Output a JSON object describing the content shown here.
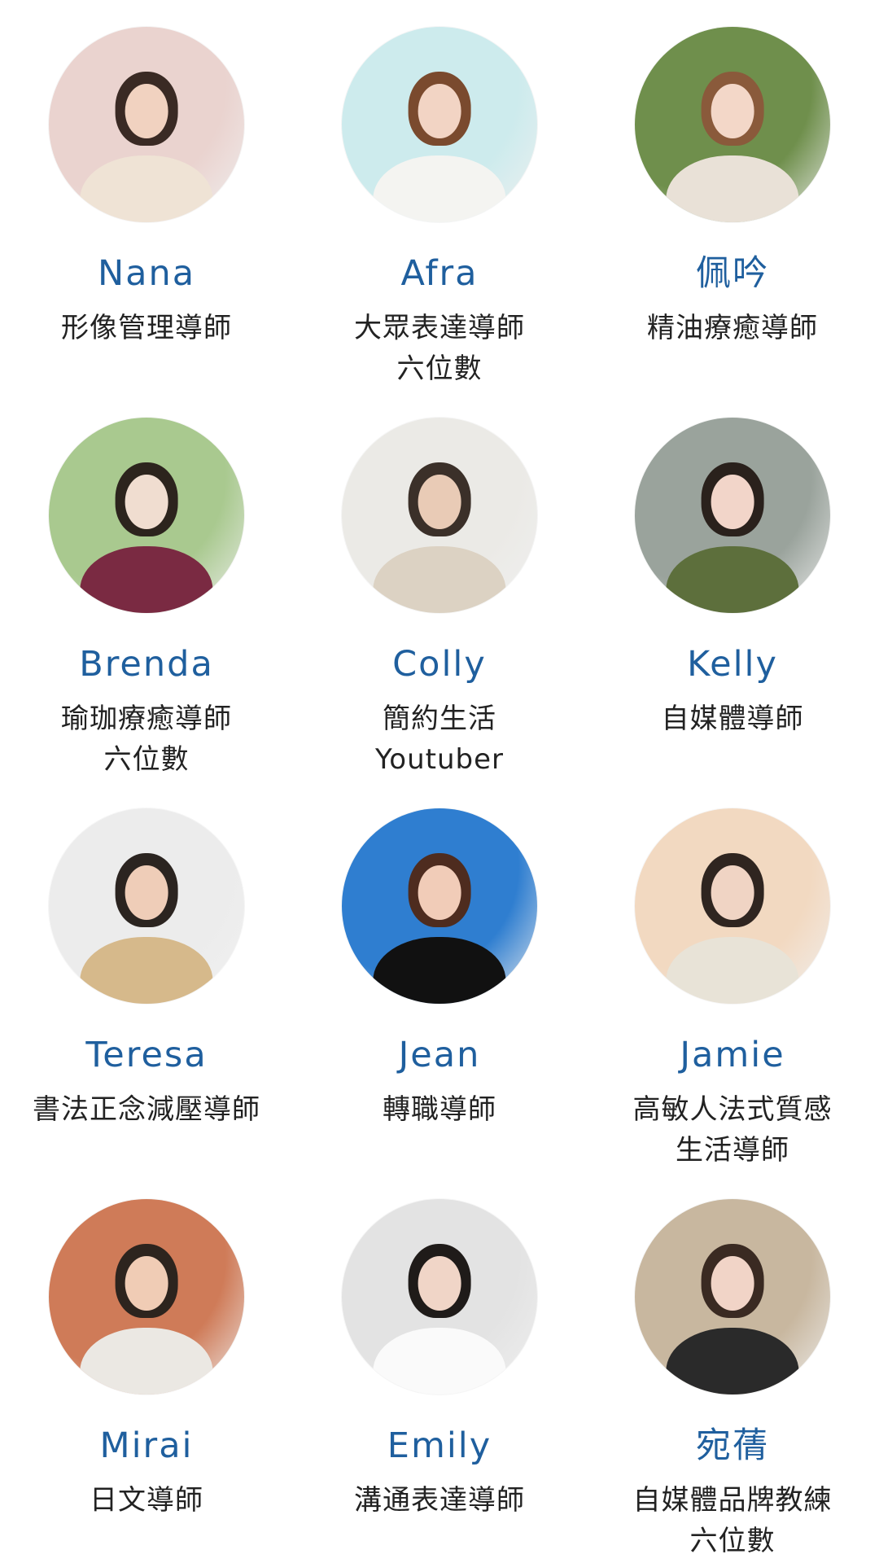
{
  "profiles": [
    {
      "name": "Nana",
      "role_lines": [
        "形像管理導師"
      ],
      "bg": "#ead3cf",
      "hair": "#3a2a24",
      "skin": "#f1d2c0",
      "body": "#efe3d5"
    },
    {
      "name": "Afra",
      "role_lines": [
        "大眾表達導師",
        "六位數"
      ],
      "bg": "#cdebed",
      "hair": "#7a4a2e",
      "skin": "#f2d4c4",
      "body": "#f4f4f1"
    },
    {
      "name": "佩吟",
      "role_lines": [
        "精油療癒導師"
      ],
      "bg": "#6f8f4c",
      "hair": "#8a5a3b",
      "skin": "#f3d7c8",
      "body": "#e9e1d7"
    },
    {
      "name": "Brenda",
      "role_lines": [
        "瑜珈療癒導師",
        "六位數"
      ],
      "bg": "#a9c98f",
      "hair": "#2c241d",
      "skin": "#f0ddd0",
      "body": "#7a2a42"
    },
    {
      "name": "Colly",
      "role_lines": [
        "簡約生活",
        "Youtuber"
      ],
      "bg": "#ebeae6",
      "hair": "#3b3029",
      "skin": "#e9cbb6",
      "body": "#dcd2c3"
    },
    {
      "name": "Kelly",
      "role_lines": [
        "自媒體導師"
      ],
      "bg": "#9aa39c",
      "hair": "#2a211c",
      "skin": "#f2d5c9",
      "body": "#5d6f3c"
    },
    {
      "name": "Teresa",
      "role_lines": [
        "書法正念減壓導師"
      ],
      "bg": "#ececec",
      "hair": "#2b2420",
      "skin": "#efcdb8",
      "body": "#d6b98b"
    },
    {
      "name": "Jean",
      "role_lines": [
        "轉職導師"
      ],
      "bg": "#2f7ed0",
      "hair": "#4e2c1f",
      "skin": "#f1ccb8",
      "body": "#111111"
    },
    {
      "name": "Jamie",
      "role_lines": [
        "高敏人法式質感",
        "生活導師"
      ],
      "bg": "#f2d9c1",
      "hair": "#2f2520",
      "skin": "#f0d4c4",
      "body": "#e8e3d7"
    },
    {
      "name": "Mirai",
      "role_lines": [
        "日文導師"
      ],
      "bg": "#cf7b58",
      "hair": "#2d241e",
      "skin": "#f0ccb5",
      "body": "#ebe8e3"
    },
    {
      "name": "Emily",
      "role_lines": [
        "溝通表達導師"
      ],
      "bg": "#e3e3e3",
      "hair": "#1f1b19",
      "skin": "#f0d5c7",
      "body": "#fafafa"
    },
    {
      "name": "宛蒨",
      "role_lines": [
        "自媒體品牌教練",
        "六位數"
      ],
      "bg": "#c8b79f",
      "hair": "#3a2a22",
      "skin": "#f1d4c7",
      "body": "#2a2a2a"
    }
  ]
}
